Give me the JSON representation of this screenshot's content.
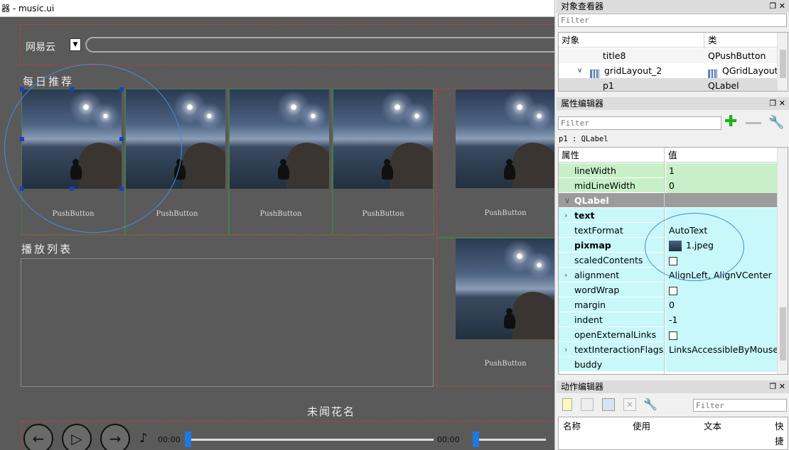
{
  "window": {
    "title": "器 - music.ui"
  },
  "designer": {
    "top_label": "网易云",
    "section_daily": "每日推荐",
    "section_playlist": "播放列表",
    "song_title": "未闻花名",
    "push_button_label": "PushButton",
    "time_current": "00:00",
    "time_total": "00:00"
  },
  "object_inspector": {
    "title": "对象查看器",
    "filter_placeholder": "Filter",
    "col_object": "对象",
    "col_class": "类",
    "rows": [
      {
        "object": "title8",
        "class": "QPushButton"
      },
      {
        "object": "gridLayout_2",
        "class": "QGridLayout"
      },
      {
        "object": "p1",
        "class": "QLabel"
      }
    ]
  },
  "property_editor": {
    "title": "属性编辑器",
    "filter_placeholder": "Filter",
    "context": "p1 : QLabel",
    "col_property": "属性",
    "col_value": "值",
    "rows": [
      {
        "name": "lineWidth",
        "value": "1"
      },
      {
        "name": "midLineWidth",
        "value": "0"
      },
      {
        "name": "QLabel",
        "value": ""
      },
      {
        "name": "text",
        "value": ""
      },
      {
        "name": "textFormat",
        "value": "AutoText"
      },
      {
        "name": "pixmap",
        "value": "1.jpeg"
      },
      {
        "name": "scaledContents",
        "value": ""
      },
      {
        "name": "alignment",
        "value": "AlignLeft, AlignVCenter"
      },
      {
        "name": "wordWrap",
        "value": ""
      },
      {
        "name": "margin",
        "value": "0"
      },
      {
        "name": "indent",
        "value": "-1"
      },
      {
        "name": "openExternalLinks",
        "value": ""
      },
      {
        "name": "textInteractionFlags",
        "value": "LinksAccessibleByMouse"
      },
      {
        "name": "buddy",
        "value": ""
      }
    ]
  },
  "action_editor": {
    "title": "动作编辑器",
    "filter_placeholder": "Filter",
    "col_name": "名称",
    "col_used": "使用",
    "col_text": "文本",
    "col_shortcut": "快捷"
  },
  "colors": {
    "green_row": "#c8f0c8",
    "cyan_row": "#c8f8fa",
    "group_row": "#9c9c9c",
    "canvas": "#5a5a5a",
    "selection": "#1a3fbf"
  }
}
